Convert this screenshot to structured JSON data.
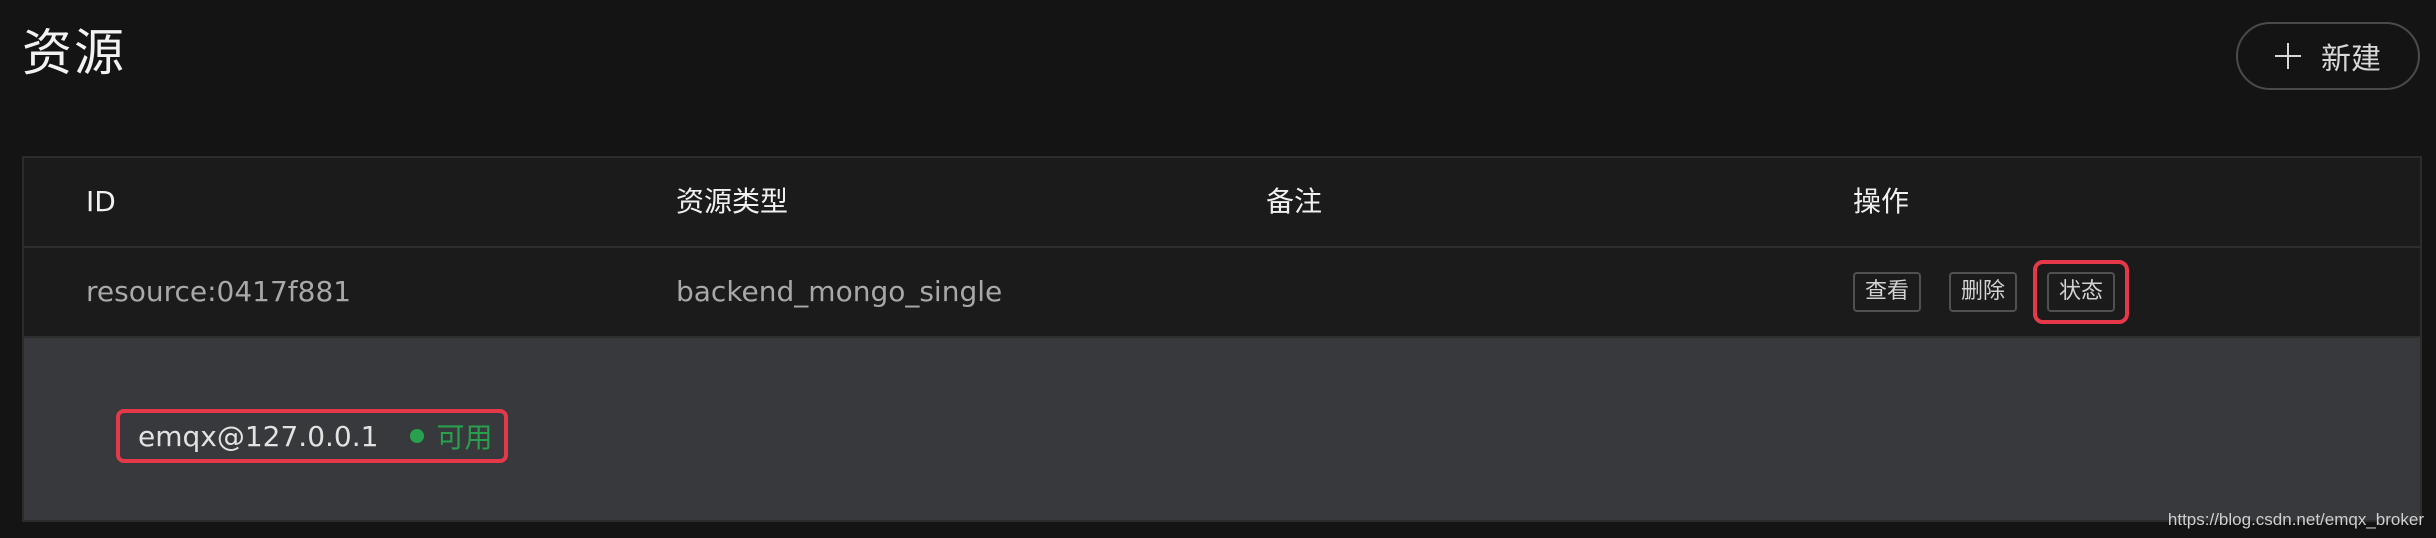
{
  "header": {
    "title": "资源",
    "new_button_label": "新建"
  },
  "table": {
    "columns": [
      "ID",
      "资源类型",
      "备注",
      "操作"
    ],
    "rows": [
      {
        "id": "resource:0417f881",
        "type": "backend_mongo_single",
        "note": "",
        "actions": [
          "查看",
          "删除",
          "状态"
        ]
      }
    ],
    "expanded": {
      "node": "emqx@127.0.0.1",
      "status": "可用",
      "status_color": "#27a14e"
    }
  },
  "highlight_color": "#e5394a",
  "watermark": "https://blog.csdn.net/emqx_broker"
}
